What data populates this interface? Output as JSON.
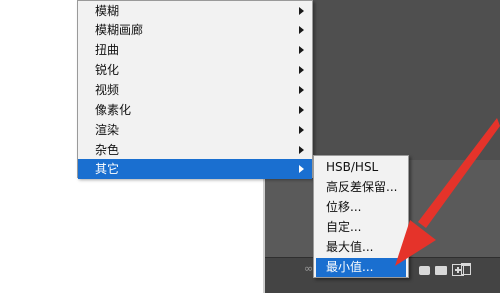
{
  "filter_menu": {
    "items": [
      {
        "label": "模糊",
        "has_submenu": true
      },
      {
        "label": "模糊画廊",
        "has_submenu": true
      },
      {
        "label": "扭曲",
        "has_submenu": true
      },
      {
        "label": "锐化",
        "has_submenu": true
      },
      {
        "label": "视频",
        "has_submenu": true
      },
      {
        "label": "像素化",
        "has_submenu": true
      },
      {
        "label": "渲染",
        "has_submenu": true
      },
      {
        "label": "杂色",
        "has_submenu": true
      },
      {
        "label": "其它",
        "has_submenu": true,
        "active": true
      }
    ]
  },
  "other_submenu": {
    "items": [
      {
        "label": "HSB/HSL"
      },
      {
        "label": "高反差保留..."
      },
      {
        "label": "位移..."
      },
      {
        "label": "自定..."
      },
      {
        "label": "最大值..."
      },
      {
        "label": "最小值...",
        "active": true
      }
    ]
  },
  "colors": {
    "highlight": "#1a6fd0",
    "annotation_arrow": "#e5332a"
  },
  "layers_panel_icons": [
    "link-icon",
    "mask-icon",
    "folder-icon",
    "new-layer-icon",
    "trash-icon"
  ]
}
